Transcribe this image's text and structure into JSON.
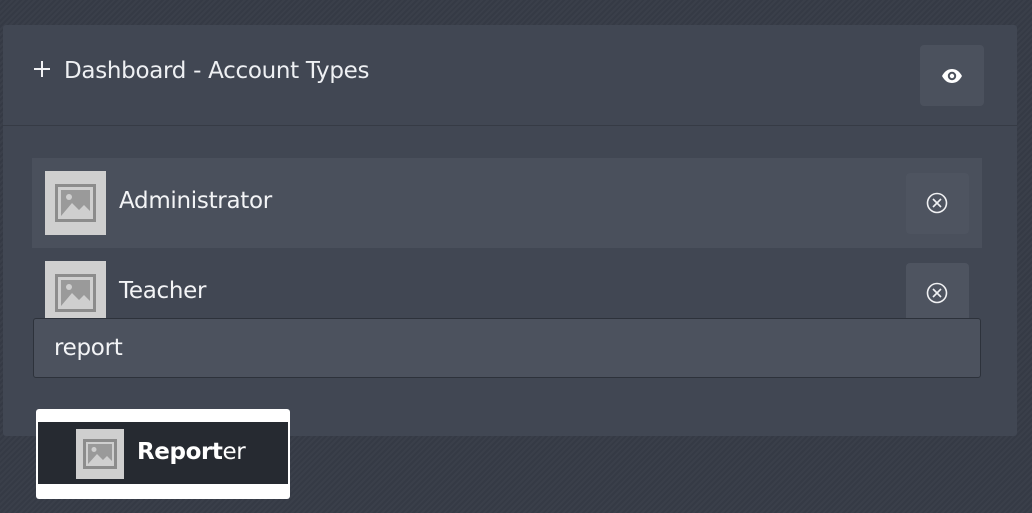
{
  "panel": {
    "title": "Dashboard - Account Types",
    "add_icon": "plus-icon",
    "visibility_icon": "eye-icon"
  },
  "selected_items": [
    {
      "label": "Administrator",
      "thumbnail_icon": "image-placeholder-icon",
      "remove_icon": "close-circle-icon"
    },
    {
      "label": "Teacher",
      "thumbnail_icon": "image-placeholder-icon",
      "remove_icon": "close-circle-icon"
    }
  ],
  "search": {
    "value": "report"
  },
  "suggestions": [
    {
      "match": "Report",
      "rest": "er",
      "thumbnail_icon": "image-placeholder-icon"
    }
  ],
  "colors": {
    "background": "#363b46",
    "panel": "#414753",
    "highlight_row": "#4a505c",
    "suggestion_bg": "#262a31",
    "text": "#f3f4f6"
  }
}
